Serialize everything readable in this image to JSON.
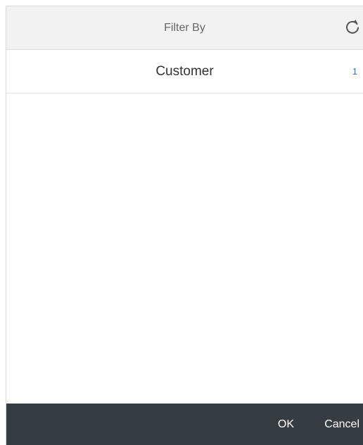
{
  "header": {
    "title": "Filter By",
    "reset_icon": "refresh-icon"
  },
  "list": {
    "items": [
      {
        "label": "Customer",
        "count": "1"
      }
    ]
  },
  "footer": {
    "ok_label": "OK",
    "cancel_label": "Cancel"
  },
  "colors": {
    "header_bg": "#f2f2f2",
    "footer_bg": "#363d42",
    "count_accent": "#2b7bd0"
  }
}
